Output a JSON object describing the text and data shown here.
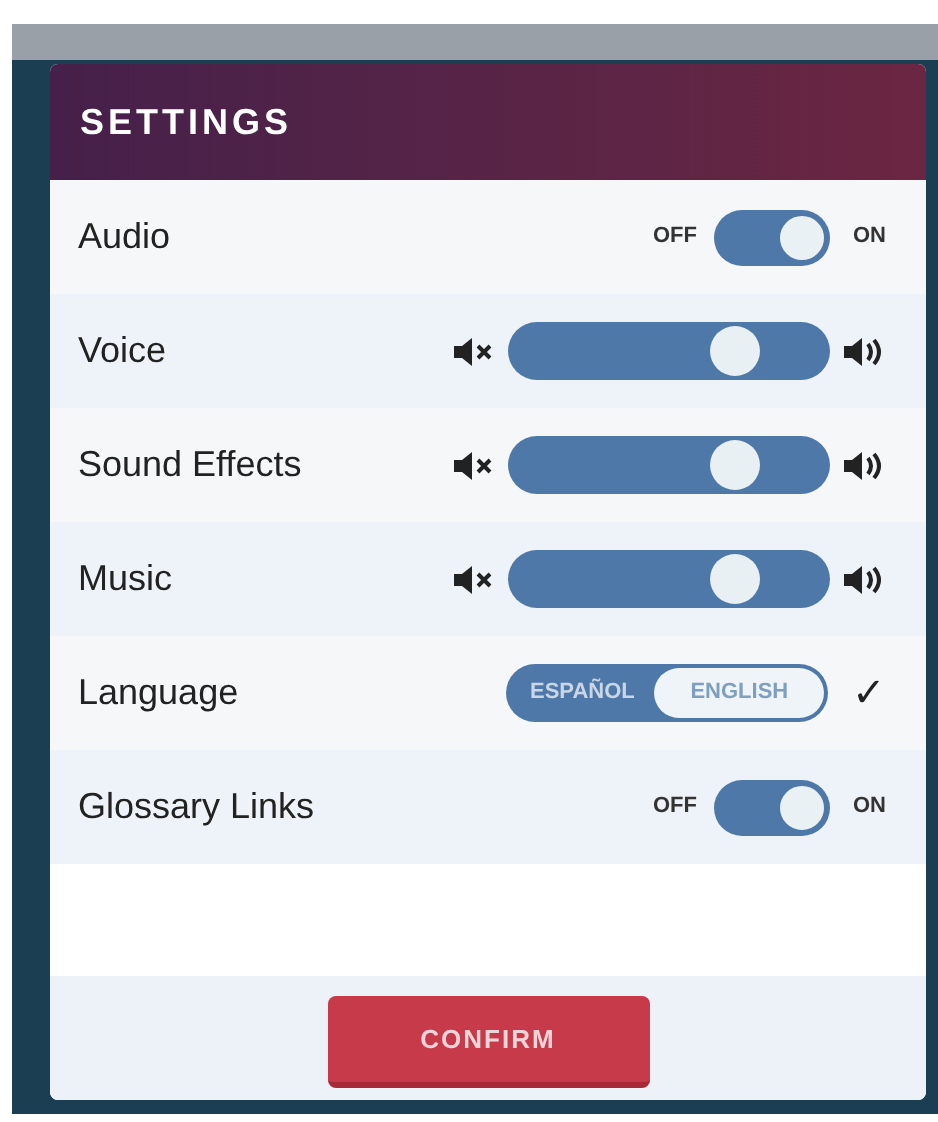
{
  "dialog": {
    "title": "SETTINGS"
  },
  "rows": [
    {
      "kind": "toggle",
      "label": "Audio",
      "off_label": "OFF",
      "on_label": "ON",
      "on": true
    },
    {
      "kind": "slider",
      "label": "Voice",
      "level": 0.7
    },
    {
      "kind": "slider",
      "label": "Sound Effects",
      "level": 0.7
    },
    {
      "kind": "slider",
      "label": "Music",
      "level": 0.7
    },
    {
      "kind": "language",
      "label": "Language",
      "options": [
        {
          "label": "ESPAÑOL",
          "selected": false
        },
        {
          "label": "ENGLISH",
          "selected": true
        }
      ],
      "check": "✓"
    },
    {
      "kind": "toggle",
      "label": "Glossary Links",
      "off_label": "OFF",
      "on_label": "ON",
      "on": true
    }
  ],
  "confirm_button": "CONFIRM"
}
